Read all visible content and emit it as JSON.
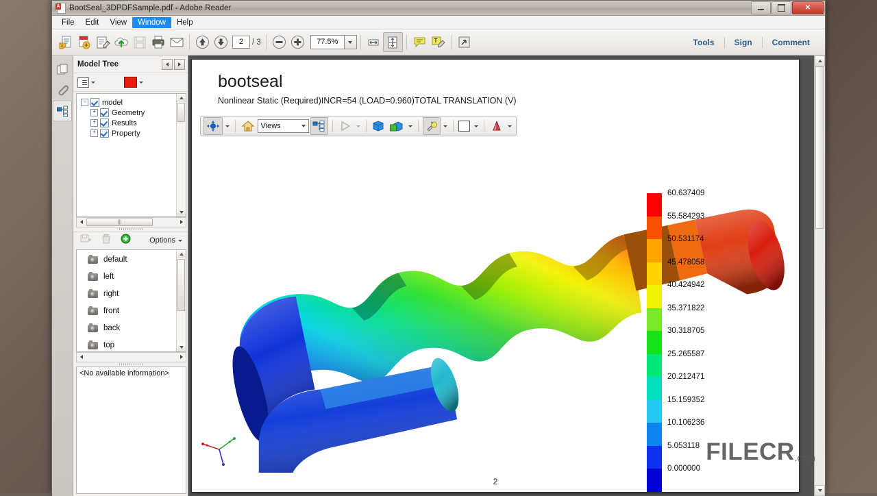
{
  "window": {
    "title": "BootSeal_3DPDFSample.pdf - Adobe Reader",
    "app_icon": "pdf-document-icon",
    "minimize_label": "Minimize",
    "maximize_label": "Maximize",
    "close_label": "✕"
  },
  "menu": {
    "items": [
      {
        "label": "File",
        "active": false
      },
      {
        "label": "Edit",
        "active": false
      },
      {
        "label": "View",
        "active": false
      },
      {
        "label": "Window",
        "active": true
      },
      {
        "label": "Help",
        "active": false
      }
    ]
  },
  "toolbar": {
    "buttons": [
      {
        "name": "open-file-icon",
        "title": "Open"
      },
      {
        "name": "create-pdf-icon",
        "title": "Create PDF"
      },
      {
        "name": "edit-pdf-icon",
        "title": "Edit PDF"
      },
      {
        "name": "cloud-upload-icon",
        "title": "Send files"
      },
      {
        "name": "save-icon",
        "title": "Save",
        "disabled": true
      },
      {
        "name": "print-icon",
        "title": "Print"
      },
      {
        "name": "email-icon",
        "title": "Email"
      }
    ],
    "prev_page_label": "Previous page",
    "next_page_label": "Next page",
    "page_number": "2",
    "page_total": "/ 3",
    "zoom_out_label": "Zoom out",
    "zoom_in_label": "Zoom in",
    "zoom_value": "77.5%",
    "fit_width_label": "Fit width",
    "fit_page_label": "Fit page",
    "comment_balloon_label": "Add sticky note",
    "highlight_label": "Highlight text",
    "fullscreen_label": "Read mode",
    "right_links": [
      "Tools",
      "Sign",
      "Comment"
    ]
  },
  "rail": {
    "items": [
      {
        "name": "page-thumbnails-icon",
        "label": "Page Thumbnails",
        "active": false
      },
      {
        "name": "attachments-icon",
        "label": "Attachments",
        "active": false
      },
      {
        "name": "model-tree-icon",
        "label": "Model Tree",
        "active": true
      }
    ]
  },
  "nav": {
    "title": "Model Tree",
    "collapse_label": "Collapse",
    "expand_label": "Expand",
    "list_view_label": "Model tree options",
    "color_swatch": "#e81a0c",
    "tree": [
      {
        "label": "model",
        "depth": 0,
        "checked": true,
        "expanded": true
      },
      {
        "label": "Geometry",
        "depth": 1,
        "checked": true,
        "expanded": false
      },
      {
        "label": "Results",
        "depth": 1,
        "checked": true,
        "expanded": false
      },
      {
        "label": "Property",
        "depth": 1,
        "checked": true,
        "expanded": false
      }
    ],
    "views_toolbar": {
      "save_view_label": "Save view",
      "delete_view_label": "Delete view",
      "add_view_label": "Add view",
      "options_label": "Options"
    },
    "views": [
      "default",
      "left",
      "right",
      "front",
      "back",
      "top"
    ],
    "info_text": "<No available information>"
  },
  "document": {
    "title": "bootseal",
    "subtitle": "Nonlinear Static (Required)INCR=54 (LOAD=0.960)TOTAL TRANSLATION (V)",
    "page_label": "2",
    "close_label": "✕",
    "toolbar3d": {
      "rotate_label": "Rotate",
      "home_label": "Default view",
      "views_select_value": "Views",
      "model_tree_label": "Toggle model tree",
      "play_label": "Play animation",
      "part_label": "Use orthographic projection",
      "cross_section_label": "Toggle cross section",
      "light_label": "Lighting",
      "background_label": "Background color",
      "render_label": "Render mode"
    },
    "watermark": {
      "main": "FILECR",
      "suffix": ".com"
    },
    "axis_triad": {
      "x_color": "#cc2222",
      "y_color": "#22aa33",
      "z_color": "#3333cc"
    }
  },
  "chart_data": {
    "type": "heatmap",
    "title": "bootseal",
    "subtitle": "Nonlinear Static (Required)INCR=54 (LOAD=0.960)TOTAL TRANSLATION (V)",
    "legend_title": "TOTAL TRANSLATION (V)",
    "legend_position": "right",
    "ylim": [
      0.0,
      60.637409
    ],
    "tick_labels": [
      "60.637409",
      "55.584293",
      "50.531174",
      "45.478058",
      "40.424942",
      "35.371822",
      "30.318705",
      "25.265587",
      "20.212471",
      "15.159352",
      "10.106236",
      "5.053118",
      "0.000000"
    ],
    "values": [
      60.637409,
      55.584293,
      50.531174,
      45.478058,
      40.424942,
      35.371822,
      30.318705,
      25.265587,
      20.212471,
      15.159352,
      10.106236,
      5.053118,
      0.0
    ],
    "band_colors": [
      "#ff0000",
      "#ff4400",
      "#ff8c00",
      "#ffc400",
      "#f5f500",
      "#b4ee00",
      "#44dd11",
      "#00d93c",
      "#00e58e",
      "#16e6d2",
      "#11a8f0",
      "#1b4ff5",
      "#0000dd"
    ],
    "colormap": "rainbow-jet"
  }
}
